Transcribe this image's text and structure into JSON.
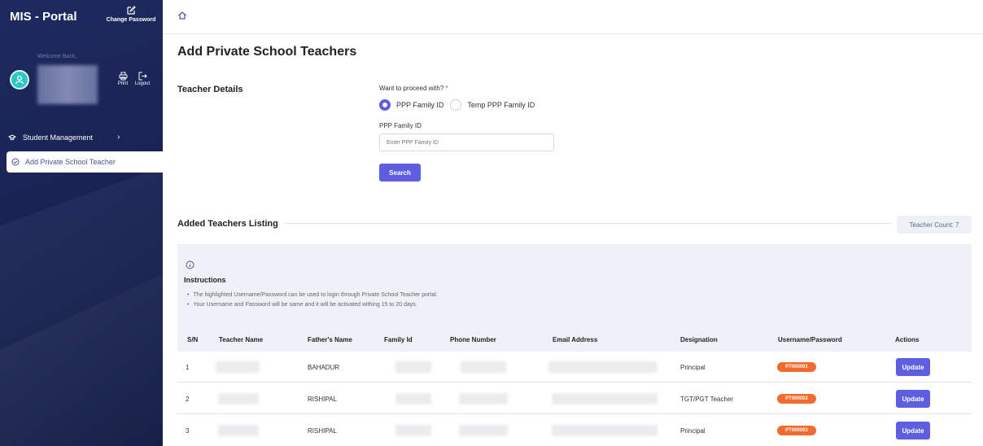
{
  "sidebar": {
    "brand": "MIS - Portal",
    "change_password": "Change Password",
    "welcome": "Welcome Back,",
    "print": "Print",
    "logout": "Logout",
    "nav": [
      {
        "label": "Student Management",
        "icon": "graduation-cap-icon"
      },
      {
        "label": "Add Private School Teacher",
        "icon": "check-circle-icon"
      }
    ]
  },
  "header": {
    "home_icon": "home-icon"
  },
  "page": {
    "title": "Add Private School Teachers",
    "section_label": "Teacher Details",
    "proceed_label": "Want to proceed with?",
    "required_mark": "*",
    "options": [
      "PPP Family ID",
      "Temp PPP Family ID"
    ],
    "selected_option": "PPP Family ID",
    "field_label": "PPP Family ID",
    "field_placeholder": "Enter PPP Family ID",
    "field_value": "",
    "search_button": "Search"
  },
  "listing": {
    "title": "Added Teachers Listing",
    "count": "Teacher Count: 7"
  },
  "instructions": {
    "title": "Instructions",
    "items": [
      "The highlighted Username/Password can be used to login through Private School Teacher portal.",
      "Your Username and Password will be same and it will be activated withing 15 to 20 days."
    ]
  },
  "table": {
    "headers": [
      "S/N",
      "Teacher Name",
      "Father's Name",
      "Family Id",
      "Phone Number",
      "Email Address",
      "Designation",
      "Username/Password",
      "Actions"
    ],
    "rows": [
      {
        "sn": "1",
        "father": "BAHADUR",
        "designation": "Principal",
        "username": "PT000001",
        "action": "Update"
      },
      {
        "sn": "2",
        "father": "RISHIPAL",
        "designation": "TGT/PGT Teacher",
        "username": "PT000002",
        "action": "Update"
      },
      {
        "sn": "3",
        "father": "RISHIPAL",
        "designation": "Principal",
        "username": "PT000003",
        "action": "Update"
      }
    ]
  },
  "colors": {
    "sidebar": "#1a2456",
    "accent": "#5d5fe0",
    "badge": "#f26b2e",
    "panel": "#eef1f7"
  }
}
